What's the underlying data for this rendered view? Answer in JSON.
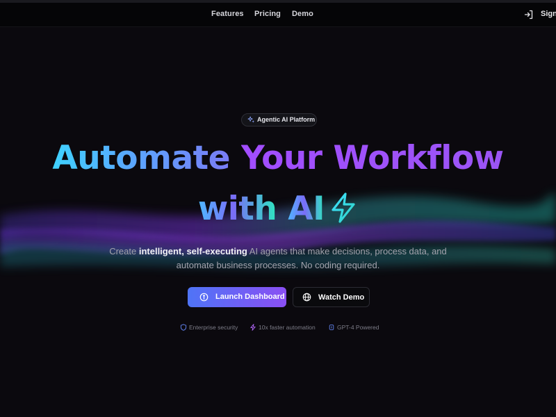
{
  "nav": {
    "links": [
      "Features",
      "Pricing",
      "Demo"
    ],
    "signin_label": "Sign"
  },
  "hero": {
    "badge_label": "Agentic AI Platform",
    "headline": {
      "part1": "Automate",
      "part2": "Your Workflow",
      "line2_a": "with",
      "line2_b": "AI"
    },
    "subtext": {
      "s1_prefix": "Create ",
      "s1_bold": "intelligent, self-executing",
      "s1_suffix": " AI agents that make decisions, process data, and",
      "s2": "automate business processes. No coding required."
    },
    "primary_button": "Launch Dashboard",
    "secondary_button": "Watch Demo",
    "features": [
      "Enterprise security",
      "10x faster automation",
      "GPT-4 Powered"
    ]
  },
  "icons": {
    "signin": "sign-in-icon",
    "badge": "sparkles-icon",
    "headline": "lightning-bolt-icon",
    "primary_button": "compass-icon",
    "secondary_button": "globe-icon",
    "features": [
      "shield-icon",
      "zap-icon",
      "chip-icon"
    ]
  },
  "colors": {
    "background": "#0b090e",
    "gradient_cyan": "#3fd2ff",
    "gradient_purple": "#a24dff",
    "gradient_teal": "#2ee6c0",
    "button_start": "#4f74f6",
    "button_end": "#8a4ff4"
  }
}
